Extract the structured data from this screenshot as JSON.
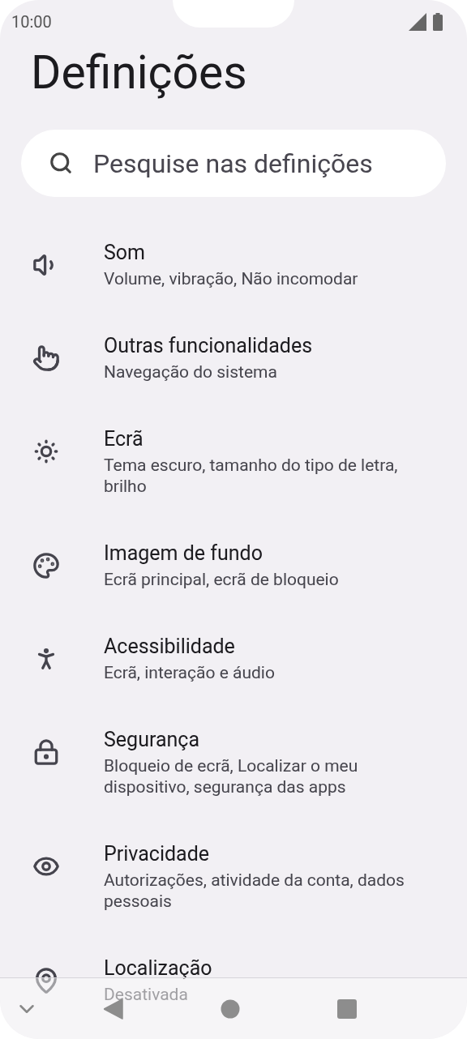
{
  "status_bar": {
    "time": "10:00"
  },
  "title": "Definições",
  "search": {
    "placeholder": "Pesquise nas definições"
  },
  "items": [
    {
      "kind": "sound",
      "title": "Som",
      "subtitle": "Volume, vibração, Não incomodar"
    },
    {
      "kind": "gesture",
      "title": "Outras funcionalidades",
      "subtitle": "Navegação do sistema"
    },
    {
      "kind": "display",
      "title": "Ecrã",
      "subtitle": "Tema escuro, tamanho do tipo de letra, brilho"
    },
    {
      "kind": "wallpaper",
      "title": "Imagem de fundo",
      "subtitle": "Ecrã principal, ecrã de bloqueio"
    },
    {
      "kind": "accessibility",
      "title": "Acessibilidade",
      "subtitle": "Ecrã, interação e áudio"
    },
    {
      "kind": "security",
      "title": "Segurança",
      "subtitle": "Bloqueio de ecrã, Localizar o meu dispositivo, segurança das apps"
    },
    {
      "kind": "privacy",
      "title": "Privacidade",
      "subtitle": "Autorizações, atividade da conta, dados pessoais"
    },
    {
      "kind": "location",
      "title": "Localização",
      "subtitle": "Desativada"
    }
  ]
}
